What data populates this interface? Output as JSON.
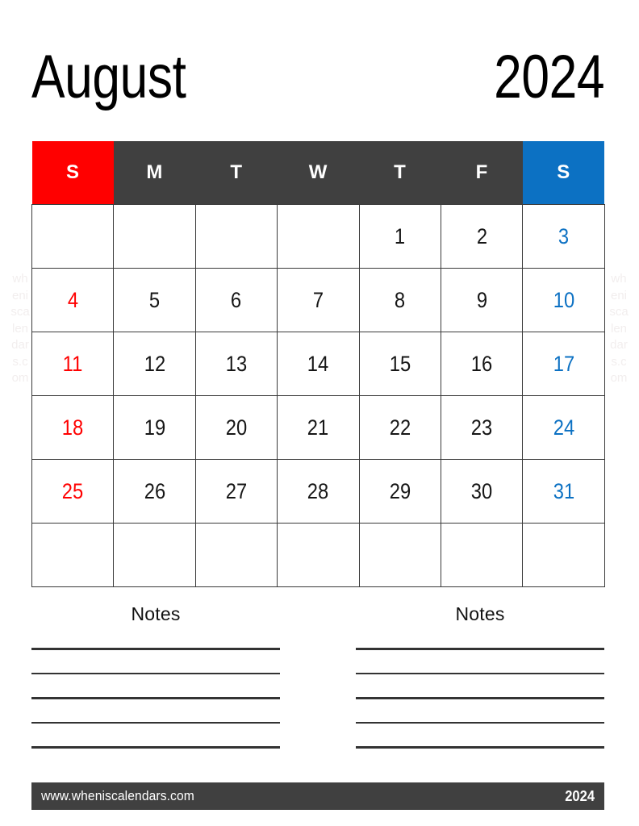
{
  "title": {
    "month": "August",
    "year": "2024"
  },
  "colors": {
    "sunday": "#ff0000",
    "weekday_header": "#404040",
    "saturday": "#0c71c3",
    "grid_line": "#3a3a3a",
    "footer_bar": "#404040",
    "watermark": "#f2eeee"
  },
  "calendar": {
    "weekday_headers": [
      {
        "label": "S",
        "kind": "sunday"
      },
      {
        "label": "M",
        "kind": "weekday"
      },
      {
        "label": "T",
        "kind": "weekday"
      },
      {
        "label": "W",
        "kind": "weekday"
      },
      {
        "label": "T",
        "kind": "weekday"
      },
      {
        "label": "F",
        "kind": "weekday"
      },
      {
        "label": "S",
        "kind": "saturday"
      }
    ],
    "weeks": [
      [
        "",
        "",
        "",
        "",
        "1",
        "2",
        "3"
      ],
      [
        "4",
        "5",
        "6",
        "7",
        "8",
        "9",
        "10"
      ],
      [
        "11",
        "12",
        "13",
        "14",
        "15",
        "16",
        "17"
      ],
      [
        "18",
        "19",
        "20",
        "21",
        "22",
        "23",
        "24"
      ],
      [
        "25",
        "26",
        "27",
        "28",
        "29",
        "30",
        "31"
      ],
      [
        "",
        "",
        "",
        "",
        "",
        "",
        ""
      ]
    ]
  },
  "watermark": {
    "text": "wheniscalendars.com"
  },
  "notes": {
    "left": {
      "title": "Notes",
      "line_count": 5
    },
    "right": {
      "title": "Notes",
      "line_count": 5
    }
  },
  "footer": {
    "url": "www.wheniscalendars.com",
    "year": "2024"
  }
}
